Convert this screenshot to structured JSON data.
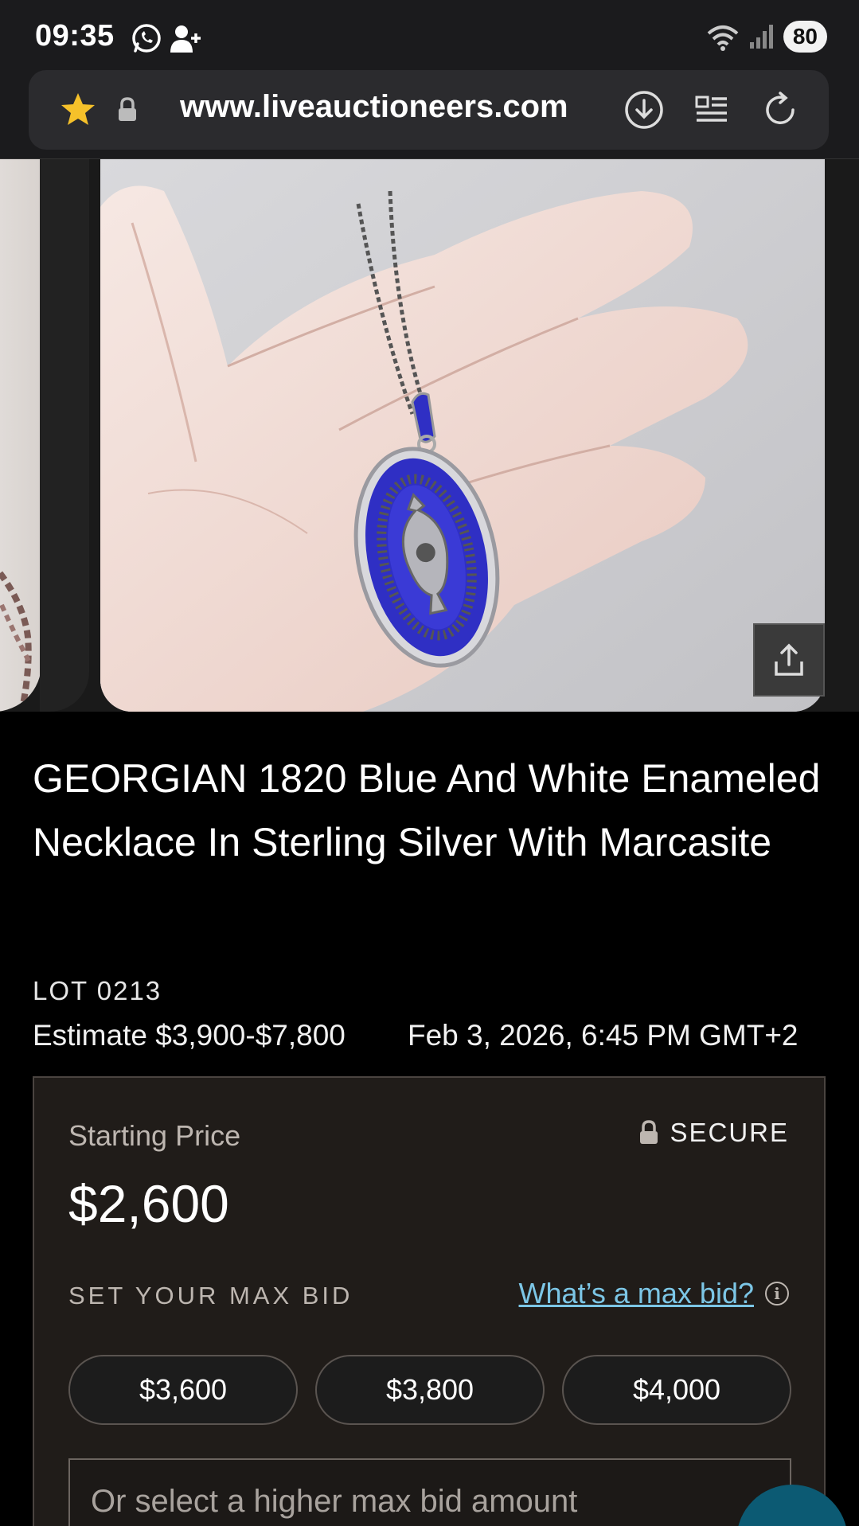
{
  "status_bar": {
    "time": "09:35",
    "battery": "80",
    "icons": [
      "whatsapp-icon",
      "person-add-icon",
      "wifi-icon",
      "signal-icon"
    ]
  },
  "browser": {
    "url": "www.liveauctioneers.com",
    "icons": [
      "star-icon",
      "lock-icon",
      "download-icon",
      "reader-icon",
      "reload-icon"
    ]
  },
  "lot": {
    "title": "GEORGIAN 1820 Blue And White Enameled Necklace In Sterling Silver With Marcasite",
    "lot_number": "LOT 0213",
    "estimate": "Estimate $3,900-$7,800",
    "date": "Feb 3, 2026, 6:45 PM GMT+2"
  },
  "bid_panel": {
    "starting_label": "Starting Price",
    "secure_label": "SECURE",
    "starting_price": "$2,600",
    "set_max_label": "SET YOUR MAX BID",
    "whats_max_link": "What’s a max bid?",
    "options": [
      "$3,600",
      "$3,800",
      "$4,000"
    ],
    "higher_placeholder": "Or select a higher max bid amount"
  },
  "colors": {
    "background": "#000000",
    "panel": "#201c19",
    "link": "#7cc6e6",
    "enamel_blue": "#2f2fc4",
    "star": "#f6c12a"
  }
}
